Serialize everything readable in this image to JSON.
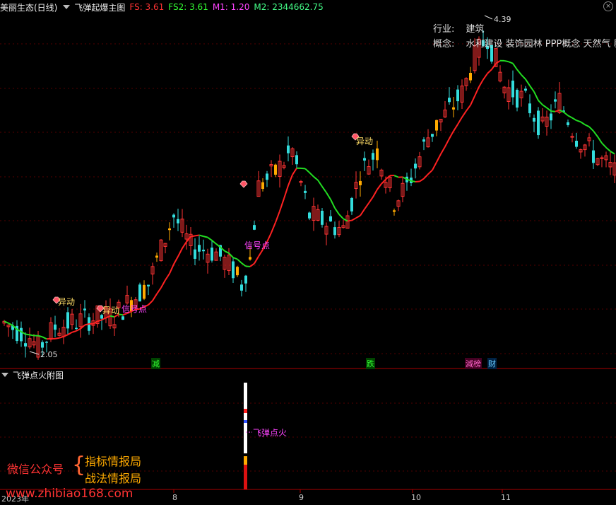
{
  "main_header": {
    "stock": "美丽生态(日线)",
    "indicator": "飞弹起爆主图",
    "fs": "FS: 3.61",
    "fs2": "FS2: 3.61",
    "m1": "M1: 1.20",
    "m2": "M2: 2344662.75"
  },
  "sub_header": {
    "indicator": "飞弹点火附图"
  },
  "info_panel": {
    "industry_label": "行业:",
    "industry_value": "建筑",
    "concept_label": "概念:",
    "concept_value": "水利建设 装饰园林 PPP概念 天然气 新型"
  },
  "annotations": {
    "high_price": "4.39",
    "low_price": "2.05",
    "yidong_1": "异动",
    "yidong_2": "异动",
    "yidong_3": "异动",
    "signal_1": "信号点",
    "signal_2": "信号点",
    "ignite": "飞弹点火"
  },
  "bottom_markers": [
    {
      "label": "减",
      "color": "#33ff33",
      "bg": "#004400"
    },
    {
      "label": "跌",
      "color": "#33ff33",
      "bg": "#004400"
    },
    {
      "label": "減榜",
      "color": "#ff66cc",
      "bg": "#440022"
    },
    {
      "label": "财",
      "color": "#66ccff",
      "bg": "#002244"
    }
  ],
  "x_axis": {
    "year": "2023年",
    "months": [
      "8",
      "9",
      "10",
      "11"
    ]
  },
  "watermark": {
    "left": "微信公众号",
    "right_1": "指标情报局",
    "right_2": "战法情报局",
    "url": "www.zhibiao168.com"
  },
  "colors": {
    "up_candle": "#ff3333",
    "down_candle": "#33dddd",
    "signal_bar": "#ffaa00",
    "ma_up": "#ff2222",
    "ma_down": "#22dd22",
    "magenta": "#ff44ff"
  },
  "icons": [
    "diamond-icon",
    "chevron-down-icon",
    "close-icon"
  ]
}
